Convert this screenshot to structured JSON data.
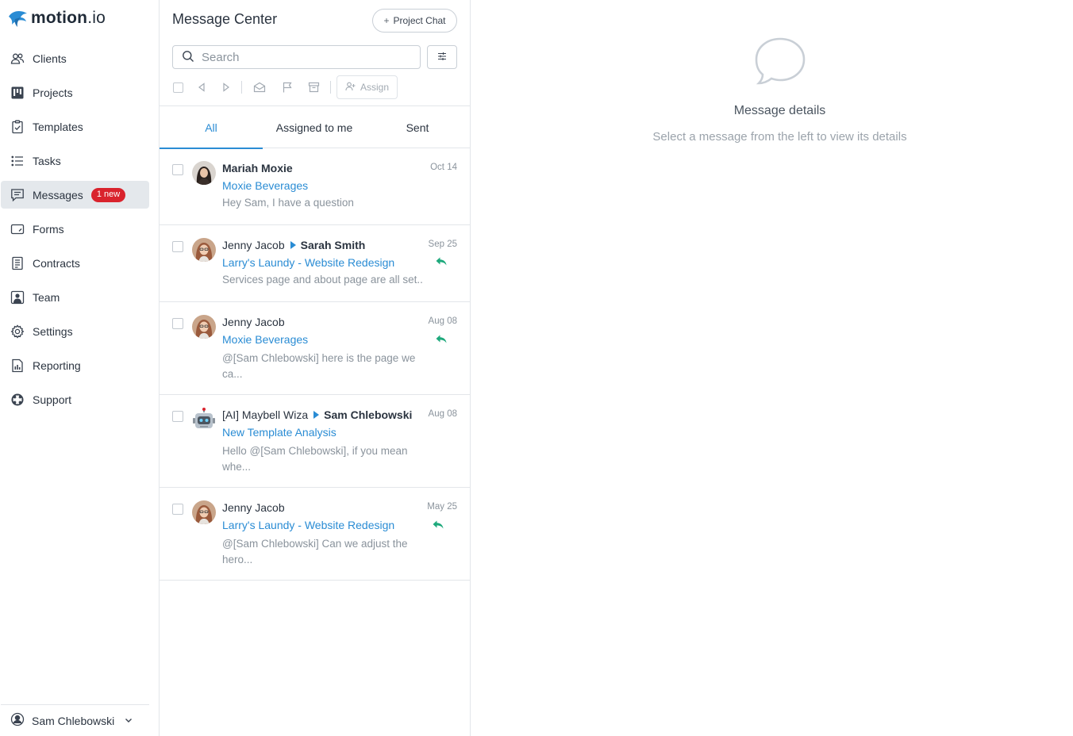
{
  "app": {
    "brand_main": "motion",
    "brand_suffix": ".io"
  },
  "sidebar": {
    "items": [
      {
        "label": "Clients",
        "icon": "users-icon"
      },
      {
        "label": "Projects",
        "icon": "kanban-icon"
      },
      {
        "label": "Templates",
        "icon": "clipboard-check-icon"
      },
      {
        "label": "Tasks",
        "icon": "list-icon"
      },
      {
        "label": "Messages",
        "icon": "message-icon",
        "badge": "1 new",
        "active": true
      },
      {
        "label": "Forms",
        "icon": "form-icon"
      },
      {
        "label": "Contracts",
        "icon": "document-icon"
      },
      {
        "label": "Team",
        "icon": "team-icon"
      },
      {
        "label": "Settings",
        "icon": "gear-icon"
      },
      {
        "label": "Reporting",
        "icon": "report-icon"
      },
      {
        "label": "Support",
        "icon": "lifebuoy-icon"
      }
    ],
    "user": {
      "name": "Sam Chlebowski"
    }
  },
  "message_center": {
    "title": "Message Center",
    "project_chat_label": "Project Chat",
    "search_placeholder": "Search",
    "assign_label": "Assign",
    "tabs": [
      {
        "label": "All",
        "active": true
      },
      {
        "label": "Assigned to me"
      },
      {
        "label": "Sent"
      }
    ],
    "messages": [
      {
        "from": "Mariah Moxie",
        "to": "",
        "project": "Moxie Beverages",
        "preview": "Hey Sam, I have a question",
        "date": "Oct 14",
        "replied": false,
        "unread": true,
        "avatar": "woman-dark"
      },
      {
        "from": "Jenny Jacob",
        "to": "Sarah Smith",
        "project": "Larry's Laundy - Website Redesign",
        "preview": "Services page and about page are all set...",
        "date": "Sep 25",
        "replied": true,
        "avatar": "woman-glasses"
      },
      {
        "from": "Jenny Jacob",
        "to": "",
        "project": "Moxie Beverages",
        "preview": "@[Sam Chlebowski] here is the page we ca...",
        "date": "Aug 08",
        "replied": true,
        "avatar": "woman-glasses"
      },
      {
        "from": "[AI] Maybell Wiza",
        "to": "Sam Chlebowski",
        "project": "New Template Analysis",
        "preview": "Hello @[Sam Chlebowski], if you mean whe...",
        "date": "Aug 08",
        "replied": false,
        "avatar": "robot"
      },
      {
        "from": "Jenny Jacob",
        "to": "",
        "project": "Larry's Laundy - Website Redesign",
        "preview": "@[Sam Chlebowski] Can we adjust the hero...",
        "date": "May 25",
        "replied": true,
        "avatar": "woman-glasses"
      }
    ]
  },
  "detail": {
    "title": "Message details",
    "subtitle": "Select a message from the left to view its details"
  },
  "colors": {
    "accent": "#2a8cd4",
    "badge": "#d9232d",
    "reply": "#1ea97c"
  }
}
